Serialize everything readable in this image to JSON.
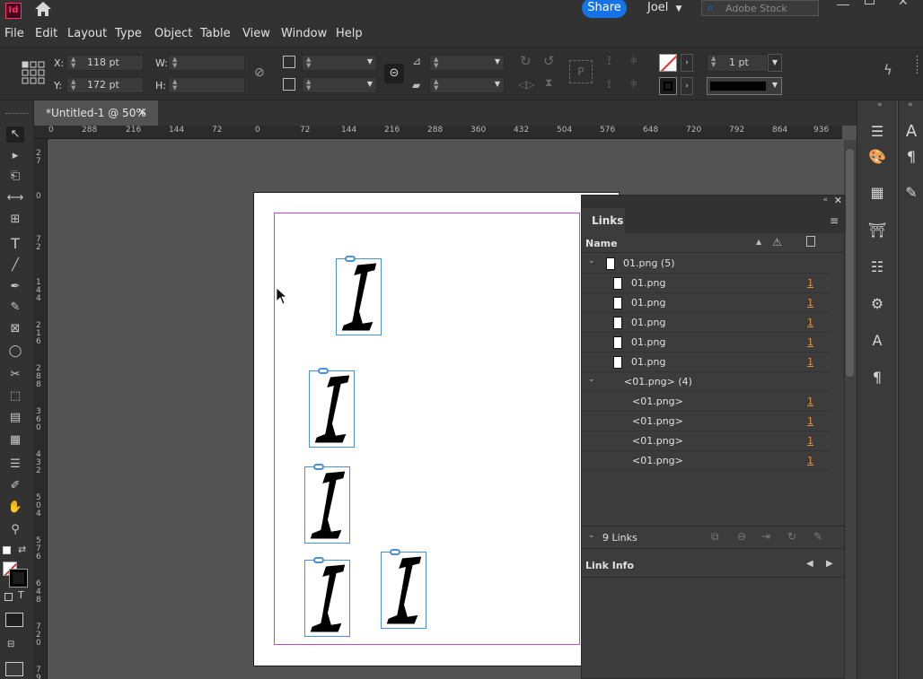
{
  "app": {
    "logo": "Id",
    "accent": "#ff3366"
  },
  "titlebar": {
    "share_label": "Share",
    "user": "Joel",
    "search_placeholder": "Adobe Stock"
  },
  "menu": [
    "File",
    "Edit",
    "Layout",
    "Type",
    "Object",
    "Table",
    "View",
    "Window",
    "Help"
  ],
  "control": {
    "x_label": "X:",
    "x_value": "118 pt",
    "y_label": "Y:",
    "y_value": "172 pt",
    "w_label": "W:",
    "w_value": "",
    "h_label": "H:",
    "h_value": "",
    "stroke_weight": "1 pt"
  },
  "document_tab": {
    "title": "*Untitled-1 @ 50%",
    "close": "×"
  },
  "ruler_h": [
    "0",
    "288",
    "216",
    "144",
    "72",
    "0",
    "72",
    "144",
    "216",
    "288",
    "360",
    "432",
    "504",
    "576",
    "648",
    "720",
    "792",
    "864",
    "936"
  ],
  "ruler_v": [
    "2\n7",
    "0",
    "7\n2",
    "1\n4\n4",
    "2\n1\n6",
    "2\n8\n8",
    "3\n6\n0",
    "4\n3\n2",
    "5\n0\n4",
    "5\n7\n6",
    "6\n4\n8",
    "7\n2\n0",
    "7\n9"
  ],
  "links_panel": {
    "tab": "Links",
    "column_name": "Name",
    "groups": [
      {
        "name": "01.png (5)",
        "items": [
          "01.png",
          "01.png",
          "01.png",
          "01.png",
          "01.png"
        ],
        "page": "1",
        "has_thumb": true
      },
      {
        "name": "<01.png> (4)",
        "items": [
          "<01.png>",
          "<01.png>",
          "<01.png>",
          "<01.png>"
        ],
        "page": "1",
        "has_thumb": false
      }
    ],
    "count_label": "9 Links",
    "link_info_label": "Link Info"
  },
  "icons": [
    "home-icon",
    "search-icon",
    "chevron-down-icon",
    "lightning-icon",
    "warning-icon",
    "page-icon",
    "menu-icon",
    "relink-icon",
    "chain-icon",
    "goto-link-icon",
    "update-icon",
    "edit-original-icon",
    "arrow-left-icon",
    "arrow-right-icon"
  ]
}
